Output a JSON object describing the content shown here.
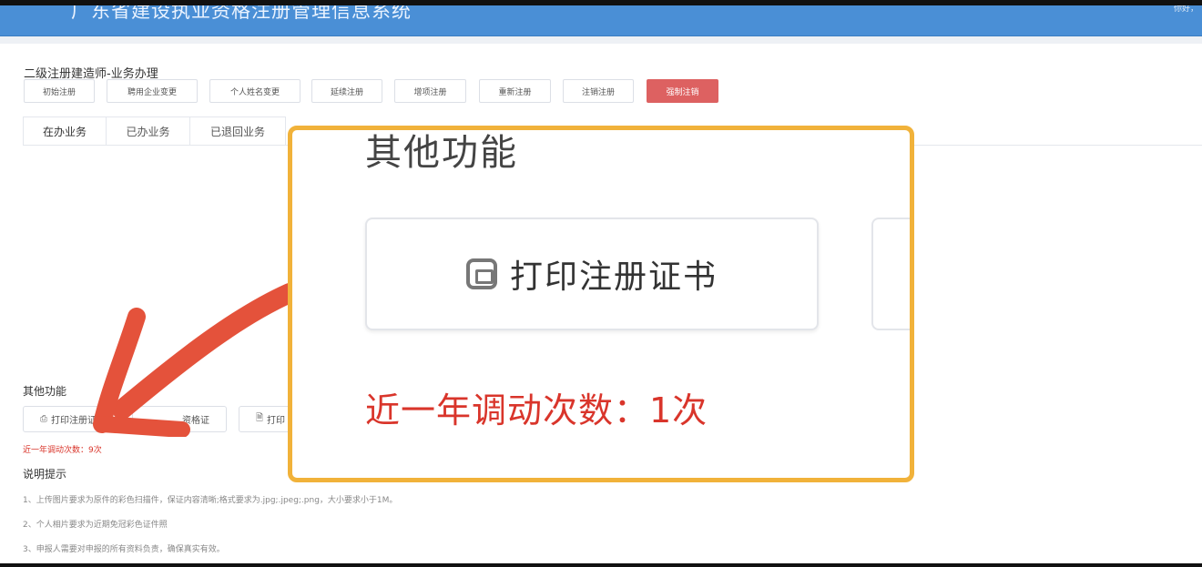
{
  "header": {
    "system_title": "广东省建设执业资格注册管理信息系统",
    "top_right": "你好，"
  },
  "page": {
    "title": "二级注册建造师-业务办理"
  },
  "business_buttons": [
    {
      "label": "初始注册"
    },
    {
      "label": "聘用企业变更"
    },
    {
      "label": "个人姓名变更"
    },
    {
      "label": "延续注册"
    },
    {
      "label": "增项注册"
    },
    {
      "label": "重新注册"
    },
    {
      "label": "注销注册"
    },
    {
      "label": "强制注销"
    }
  ],
  "tabs": [
    {
      "label": "在办业务"
    },
    {
      "label": "已办业务"
    },
    {
      "label": "已退回业务"
    }
  ],
  "other_functions": {
    "title": "其他功能",
    "buttons": [
      {
        "label": "打印注册证书",
        "icon": "printer-icon"
      },
      {
        "label": "资格证",
        "icon": "certificate-icon"
      },
      {
        "label": "打印",
        "icon": "document-icon"
      }
    ],
    "mobility_count": "近一年调动次数：9次"
  },
  "notes": {
    "title": "说明提示",
    "items": [
      "1、上传图片要求为原件的彩色扫描件，保证内容清晰;格式要求为.jpg;.jpeg;.png，大小要求小于1M。",
      "2、个人相片要求为近期免冠彩色证件照",
      "3、申报人需要对申报的所有资料负责，确保真实有效。"
    ]
  },
  "zoom_callout": {
    "title": "其他功能",
    "button_label": "打印注册证书",
    "mobility_count": "近一年调动次数：1次"
  },
  "colors": {
    "header_bg": "#4a8fd6",
    "danger": "#dd6161",
    "warning_text": "#d9352b",
    "callout_border": "#f1b23a",
    "arrow": "#e4523b"
  }
}
